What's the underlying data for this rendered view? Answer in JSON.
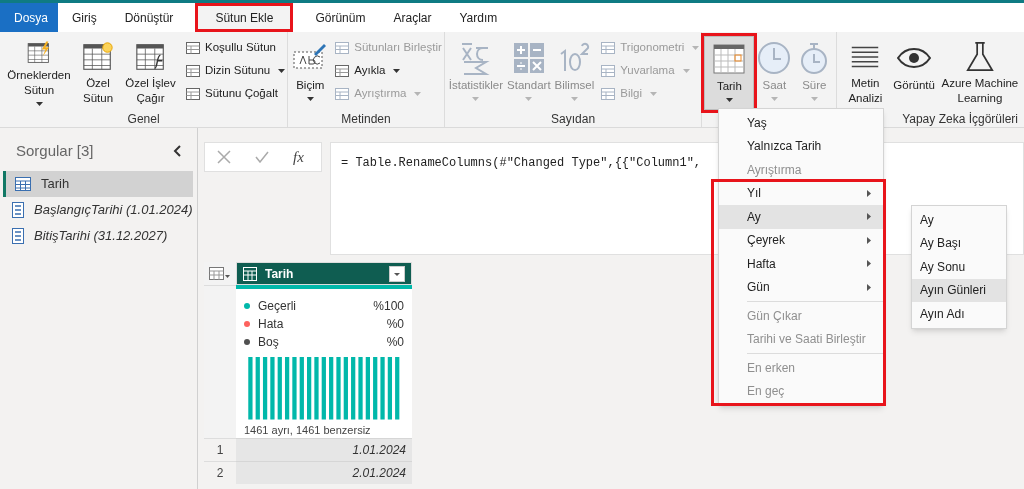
{
  "tabs": [
    {
      "label": "Dosya",
      "kind": "file",
      "selected": false,
      "highlighted": false
    },
    {
      "label": "Giriş",
      "kind": "tab",
      "selected": false,
      "highlighted": false
    },
    {
      "label": "Dönüştür",
      "kind": "tab",
      "selected": false,
      "highlighted": false
    },
    {
      "label": "Sütun Ekle",
      "kind": "tab",
      "selected": true,
      "highlighted": true
    },
    {
      "label": "Görünüm",
      "kind": "tab",
      "selected": false,
      "highlighted": false
    },
    {
      "label": "Araçlar",
      "kind": "tab",
      "selected": false,
      "highlighted": false
    },
    {
      "label": "Yardım",
      "kind": "tab",
      "selected": false,
      "highlighted": false
    }
  ],
  "ribbon": {
    "groups": [
      {
        "label": "Genel",
        "large_buttons": [
          {
            "label": "Örneklerden Sütun",
            "dropdown": true,
            "disabled": false,
            "pressed": false,
            "highlighted": false
          },
          {
            "label": "Özel Sütun",
            "dropdown": false,
            "disabled": false,
            "pressed": false,
            "highlighted": false
          },
          {
            "label": "Özel İşlev Çağır",
            "dropdown": false,
            "disabled": false,
            "pressed": false,
            "highlighted": false
          }
        ],
        "small_buttons": [
          {
            "label": "Koşullu Sütun",
            "dropdown": false,
            "disabled": false
          },
          {
            "label": "Dizin Sütunu",
            "dropdown": true,
            "disabled": false
          },
          {
            "label": "Sütunu Çoğalt",
            "dropdown": false,
            "disabled": false
          }
        ]
      },
      {
        "label": "Metinden",
        "large_buttons": [
          {
            "label": "Biçim",
            "dropdown": true,
            "disabled": false,
            "pressed": false,
            "highlighted": false
          }
        ],
        "small_buttons": [
          {
            "label": "Sütunları Birleştir",
            "dropdown": false,
            "disabled": true
          },
          {
            "label": "Ayıkla",
            "dropdown": true,
            "disabled": false
          },
          {
            "label": "Ayrıştırma",
            "dropdown": true,
            "disabled": true
          }
        ]
      },
      {
        "label": "Sayıdan",
        "large_buttons": [
          {
            "label": "İstatistikler",
            "dropdown": true,
            "disabled": true,
            "pressed": false,
            "highlighted": false
          },
          {
            "label": "Standart",
            "dropdown": true,
            "disabled": true,
            "pressed": false,
            "highlighted": false
          },
          {
            "label": "Bilimsel",
            "dropdown": true,
            "disabled": true,
            "pressed": false,
            "highlighted": false
          }
        ],
        "small_buttons": [
          {
            "label": "Trigonometri",
            "dropdown": true,
            "disabled": true
          },
          {
            "label": "Yuvarlama",
            "dropdown": true,
            "disabled": true
          },
          {
            "label": "Bilgi",
            "dropdown": true,
            "disabled": true
          }
        ]
      },
      {
        "large_buttons": [
          {
            "label": "Tarih",
            "dropdown": true,
            "disabled": false,
            "pressed": true,
            "highlighted": true
          },
          {
            "label": "Saat",
            "dropdown": true,
            "disabled": true,
            "pressed": false,
            "highlighted": false
          },
          {
            "label": "Süre",
            "dropdown": true,
            "disabled": true,
            "pressed": false,
            "highlighted": false
          }
        ]
      },
      {
        "label": "Yapay Zeka İçgörüleri",
        "large_buttons": [
          {
            "label": "Metin Analizi",
            "dropdown": false,
            "disabled": false,
            "pressed": false,
            "highlighted": false
          },
          {
            "label": "Görüntü",
            "dropdown": false,
            "disabled": false,
            "pressed": false,
            "highlighted": false
          },
          {
            "label": "Azure Machine Learning",
            "dropdown": false,
            "disabled": false,
            "pressed": false,
            "highlighted": false
          }
        ]
      }
    ]
  },
  "queries": {
    "title": "Sorgular [3]",
    "items": [
      {
        "label": "Tarih",
        "kind": "table",
        "selected": true
      },
      {
        "label": "BaşlangıçTarihi (1.01.2024)",
        "kind": "parameter",
        "selected": false
      },
      {
        "label": "BitişTarihi (31.12.2027)",
        "kind": "parameter",
        "selected": false
      }
    ]
  },
  "formula_bar": {
    "fx": "fx",
    "formula": "= Table.RenameColumns(#\"Changed Type\",{{\"Column1\","
  },
  "grid": {
    "column": "Tarih",
    "profile": [
      {
        "label": "Geçerli",
        "value": "%100",
        "color": "#01b8aa"
      },
      {
        "label": "Hata",
        "value": "%0",
        "color": "#fd625e"
      },
      {
        "label": "Boş",
        "value": "%0",
        "color": "#505050"
      }
    ],
    "distinct": "1461 ayrı, 1461 benzersiz",
    "rows": [
      {
        "number": "1",
        "value": "1.01.2024"
      },
      {
        "number": "2",
        "value": "2.01.2024"
      }
    ]
  },
  "menu": {
    "sections": [
      {
        "highlighted": false,
        "items": [
          {
            "label": "Yaş",
            "disabled": false,
            "selected": false,
            "separator_before": false
          },
          {
            "label": "Yalnızca Tarih",
            "disabled": false,
            "selected": false,
            "separator_before": false
          },
          {
            "label": "Ayrıştırma",
            "disabled": true,
            "selected": false,
            "separator_before": false
          }
        ]
      },
      {
        "highlighted": true,
        "items": [
          {
            "label": "Yıl",
            "disabled": false,
            "selected": false,
            "separator_before": false,
            "has_submenu": true
          },
          {
            "label": "Ay",
            "disabled": false,
            "selected": true,
            "separator_before": false,
            "has_submenu": true,
            "submenu": [
              {
                "label": "Ay",
                "selected": false
              },
              {
                "label": "Ay Başı",
                "selected": false
              },
              {
                "label": "Ay Sonu",
                "selected": false
              },
              {
                "label": "Ayın Günleri",
                "selected": true
              },
              {
                "label": "Ayın Adı",
                "selected": false
              }
            ]
          },
          {
            "label": "Çeyrek",
            "disabled": false,
            "selected": false,
            "separator_before": false,
            "has_submenu": true
          },
          {
            "label": "Hafta",
            "disabled": false,
            "selected": false,
            "separator_before": false,
            "has_submenu": true
          },
          {
            "label": "Gün",
            "disabled": false,
            "selected": false,
            "separator_before": false,
            "has_submenu": true
          },
          {
            "label": "Gün Çıkar",
            "disabled": true,
            "selected": false,
            "separator_before": true
          },
          {
            "label": "Tarihi ve Saati Birleştir",
            "disabled": true,
            "selected": false,
            "separator_before": false
          },
          {
            "label": "En erken",
            "disabled": true,
            "selected": false,
            "separator_before": true
          },
          {
            "label": "En geç",
            "disabled": true,
            "selected": false,
            "separator_before": false
          }
        ]
      }
    ]
  }
}
